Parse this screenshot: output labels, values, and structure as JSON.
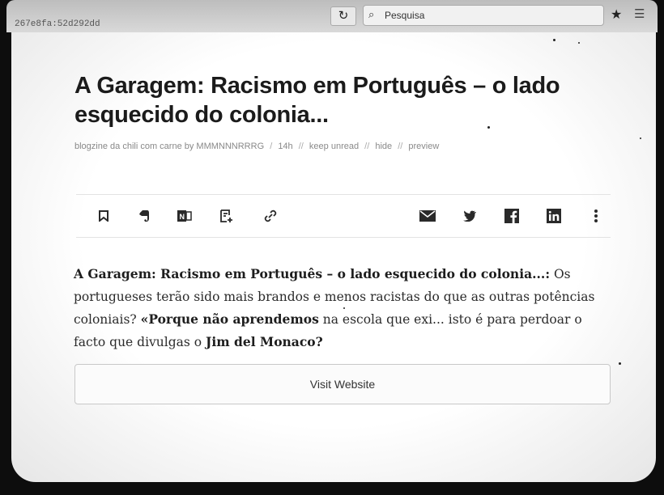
{
  "browser": {
    "url_fragment": "267e8fa:52d292dd",
    "reload_icon": "reload-icon",
    "search_placeholder": "Pesquisa"
  },
  "article": {
    "title": "A Garagem: Racismo em Português – o lado esquecido do colonia...",
    "meta": {
      "source": "blogzine da chili com carne by MMMNNNRRRG",
      "age": "14h",
      "keep_unread": "keep unread",
      "hide": "hide",
      "preview": "preview"
    },
    "excerpt": {
      "lead": "A Garagem: Racismo em Português – o lado esquecido do colonia...:",
      "p1": " Os portugueses terão sido mais brandos",
      "p2": " e menos racistas do que as outras potências coloniais? ",
      "p3": "«Porque não aprendemos",
      "p4": " na escola que exi... isto é para perdoar o facto que divulgas o ",
      "p5": "Jim del Monaco?"
    },
    "visit_label": "Visit Website"
  },
  "toolbar": {
    "left_icons": [
      "bookmark-icon",
      "evernote-icon",
      "onenote-icon",
      "add-note-icon",
      "link-icon"
    ],
    "right_icons": [
      "email-icon",
      "twitter-icon",
      "facebook-icon",
      "linkedin-icon",
      "more-icon"
    ]
  }
}
